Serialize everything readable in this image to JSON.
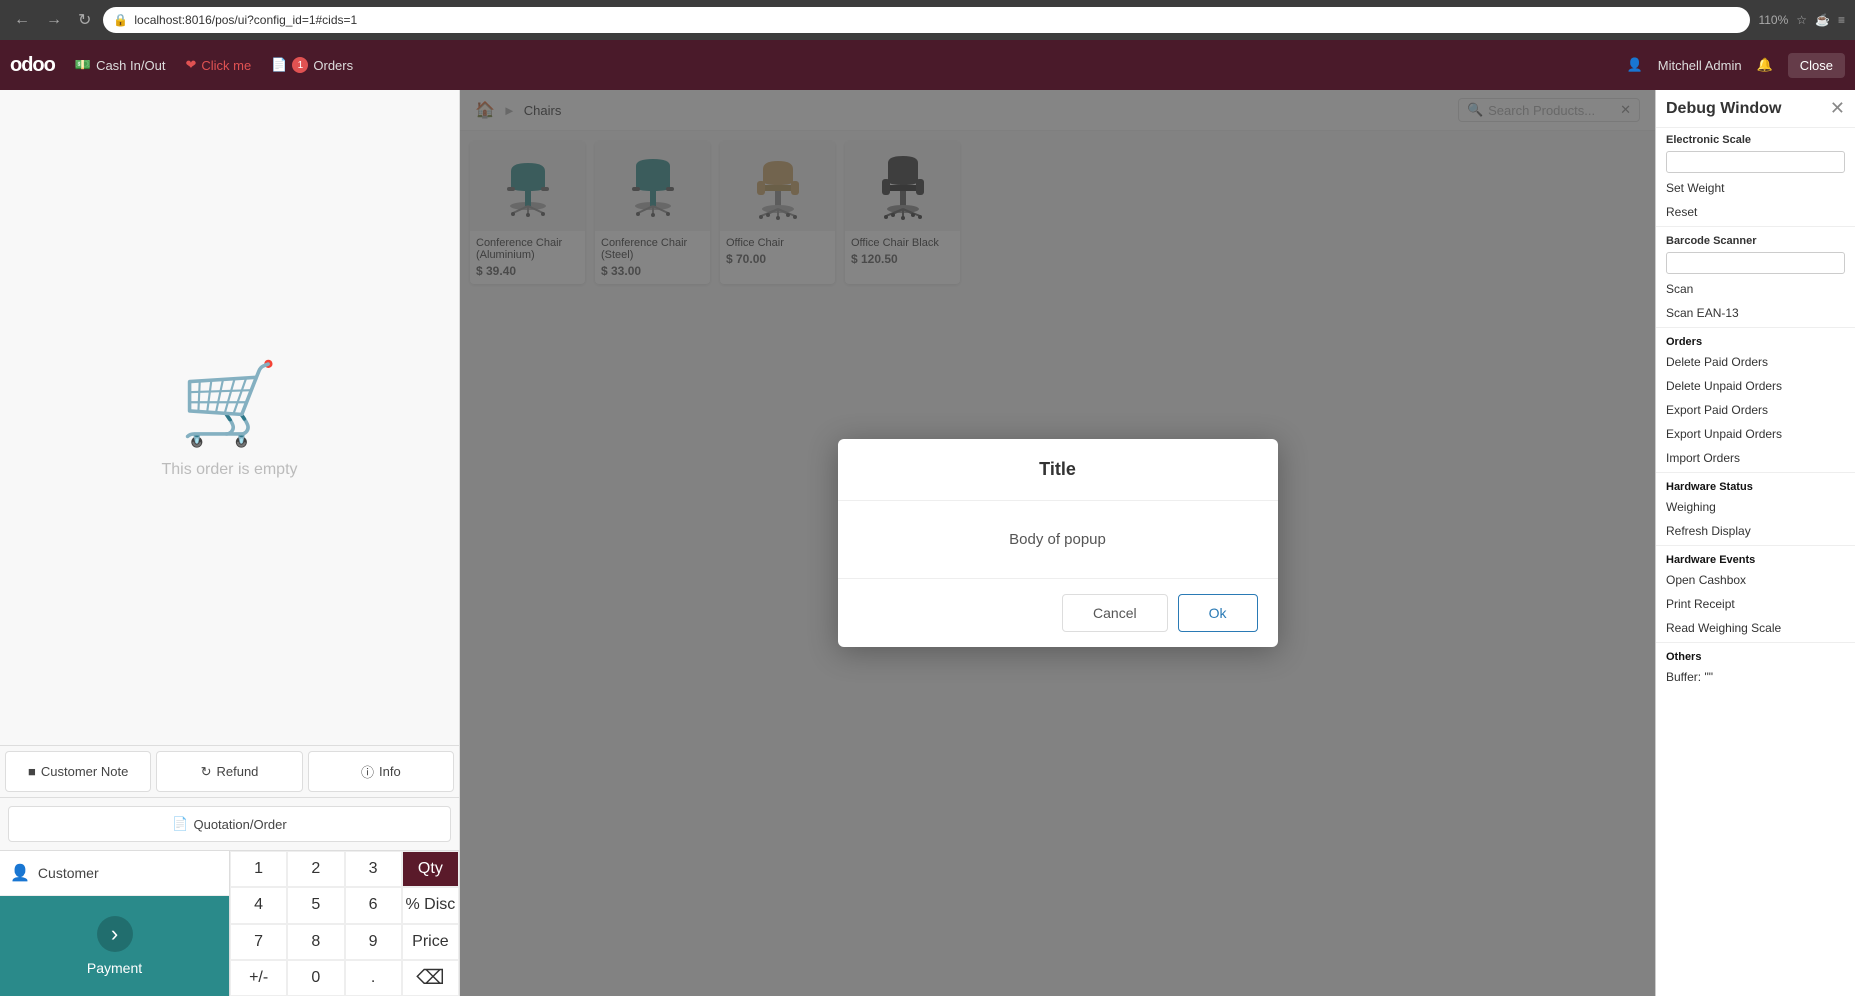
{
  "browser": {
    "url": "localhost:8016/pos/ui?config_id=1#cids=1",
    "zoom": "110%"
  },
  "topnav": {
    "logo": "odoo",
    "items": [
      {
        "id": "cash-in-out",
        "label": "Cash In/Out",
        "icon": "cash-icon"
      },
      {
        "id": "click-me",
        "label": "Click me",
        "icon": "heart-icon",
        "highlight": true
      },
      {
        "id": "orders",
        "label": "Orders",
        "icon": "orders-icon",
        "badge": "1"
      }
    ],
    "user": "Mitchell Admin",
    "close_label": "Close"
  },
  "order_panel": {
    "empty_text": "This order is empty",
    "actions": [
      {
        "id": "customer-note",
        "label": "Customer Note",
        "icon": "note-icon"
      },
      {
        "id": "refund",
        "label": "Refund",
        "icon": "refund-icon"
      },
      {
        "id": "info",
        "label": "Info",
        "icon": "info-icon"
      }
    ],
    "quotation_label": "Quotation/Order",
    "quotation_icon": "file-icon"
  },
  "numpad": {
    "customer_label": "Customer",
    "payment_label": "Payment",
    "keys": [
      [
        "1",
        "2",
        "3",
        "Qty"
      ],
      [
        "4",
        "5",
        "6",
        "% Disc"
      ],
      [
        "7",
        "8",
        "9",
        "Price"
      ],
      [
        "+/-",
        "0",
        ".",
        "⌫"
      ]
    ],
    "active_key": "Qty"
  },
  "product_area": {
    "breadcrumbs": [
      "home",
      "Chairs"
    ],
    "search_placeholder": "Search Products...",
    "products": [
      {
        "id": "conf-chair-al",
        "name": "Conference Chair (Aluminium)",
        "price": "$ 39.40",
        "color": "#2a8a8a"
      },
      {
        "id": "conf-chair-steel",
        "name": "Conference Chair (Steel)",
        "price": "$ 33.00",
        "color": "#2a8a8a"
      },
      {
        "id": "office-chair",
        "name": "Office Chair",
        "price": "$ 70.00",
        "color": "#c8a060"
      },
      {
        "id": "office-chair-black",
        "name": "Office Chair Black",
        "price": "$ 120.50",
        "color": "#333"
      }
    ]
  },
  "modal": {
    "title": "Title",
    "body": "Body of popup",
    "cancel_label": "Cancel",
    "ok_label": "Ok"
  },
  "debug_panel": {
    "title": "Debug Window",
    "electronic_scale_label": "Electronic Scale",
    "set_weight_label": "Set Weight",
    "reset_label": "Reset",
    "barcode_scanner_label": "Barcode Scanner",
    "scan_label": "Scan",
    "scan_ean13_label": "Scan EAN-13",
    "orders_section": "Orders",
    "delete_paid_label": "Delete Paid Orders",
    "delete_unpaid_label": "Delete Unpaid Orders",
    "export_paid_label": "Export Paid Orders",
    "export_unpaid_label": "Export Unpaid Orders",
    "import_orders_label": "Import Orders",
    "hardware_status_label": "Hardware Status",
    "weighing_label": "Weighing",
    "refresh_display_label": "Refresh Display",
    "hardware_events_label": "Hardware Events",
    "open_cashbox_label": "Open Cashbox",
    "print_receipt_label": "Print Receipt",
    "read_weighing_label": "Read Weighing Scale",
    "others_label": "Others",
    "buffer_label": "Buffer: \"\""
  }
}
